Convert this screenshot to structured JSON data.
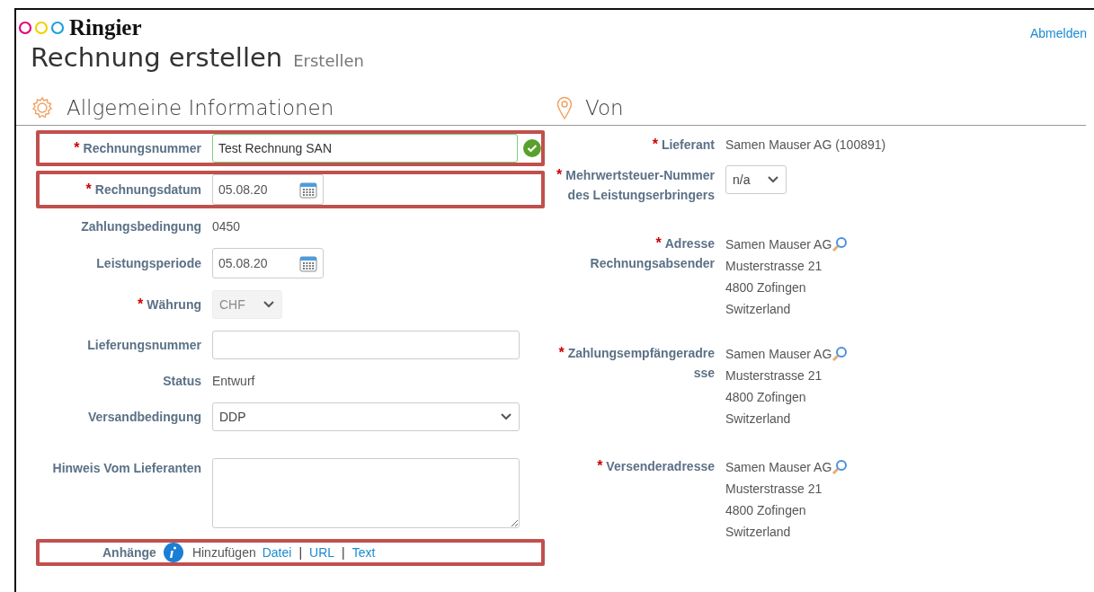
{
  "logo": {
    "text": "Ringier"
  },
  "signout": "Abmelden",
  "title": "Rechnung erstellen",
  "subtitle": "Erstellen",
  "required_mark": "*",
  "general": {
    "heading": "Allgemeine Informationen",
    "rows": [
      {
        "kind": "text",
        "label": "Rechnungsnummer",
        "required": true,
        "highlighted": true,
        "value": "Test Rechnung SAN",
        "valid": true
      },
      {
        "kind": "date",
        "label": "Rechnungsdatum",
        "required": true,
        "highlighted": true,
        "value": "05.08.20"
      },
      {
        "kind": "static",
        "label": "Zahlungsbedingung",
        "required": false,
        "highlighted": false,
        "value": "0450"
      },
      {
        "kind": "date",
        "label": "Leistungsperiode",
        "required": false,
        "highlighted": false,
        "value": "05.08.20"
      },
      {
        "kind": "select",
        "label": "Währung",
        "required": true,
        "highlighted": false,
        "value": "CHF",
        "disabled": true,
        "wide": false
      },
      {
        "kind": "text",
        "label": "Lieferungsnummer",
        "required": false,
        "highlighted": false,
        "valid": false
      },
      {
        "kind": "static",
        "label": "Status",
        "required": false,
        "highlighted": false,
        "value": "Entwurf"
      },
      {
        "kind": "select",
        "label": "Versandbedingung",
        "required": false,
        "highlighted": false,
        "value": "DDP",
        "disabled": false,
        "wide": true
      },
      {
        "kind": "textarea",
        "label": "Hinweis Vom Lieferanten",
        "required": false,
        "highlighted": false
      },
      {
        "kind": "attachments",
        "label": "Anhänge",
        "required": false,
        "highlighted": true,
        "prefix": "Hinzufügen",
        "links": [
          "Datei",
          "URL",
          "Text"
        ],
        "separator": "|"
      }
    ]
  },
  "from": {
    "heading": "Von",
    "rows": [
      {
        "kind": "static",
        "label": "Lieferant",
        "required": true,
        "value": "Samen Mauser AG (100891)"
      },
      {
        "kind": "select",
        "label": "Mehrwertsteuer-Nummer des Leistungserbringers",
        "required": true,
        "value": "n/a",
        "disabled": false,
        "wide": false
      },
      {
        "kind": "address",
        "label": "Adresse Rechnungsabsender",
        "required": true,
        "lines": [
          "Samen Mauser AG",
          "Musterstrasse 21",
          "4800 Zofingen",
          "Switzerland"
        ]
      },
      {
        "kind": "address",
        "label": "Zahlungsempfängeradresse",
        "required": true,
        "lines": [
          "Samen Mauser AG",
          "Musterstrasse 21",
          "4800 Zofingen",
          "Switzerland"
        ]
      },
      {
        "kind": "address",
        "label": "Versenderadresse",
        "required": true,
        "lines": [
          "Samen Mauser AG",
          "Musterstrasse 21",
          "4800 Zofingen",
          "Switzerland"
        ]
      }
    ]
  }
}
